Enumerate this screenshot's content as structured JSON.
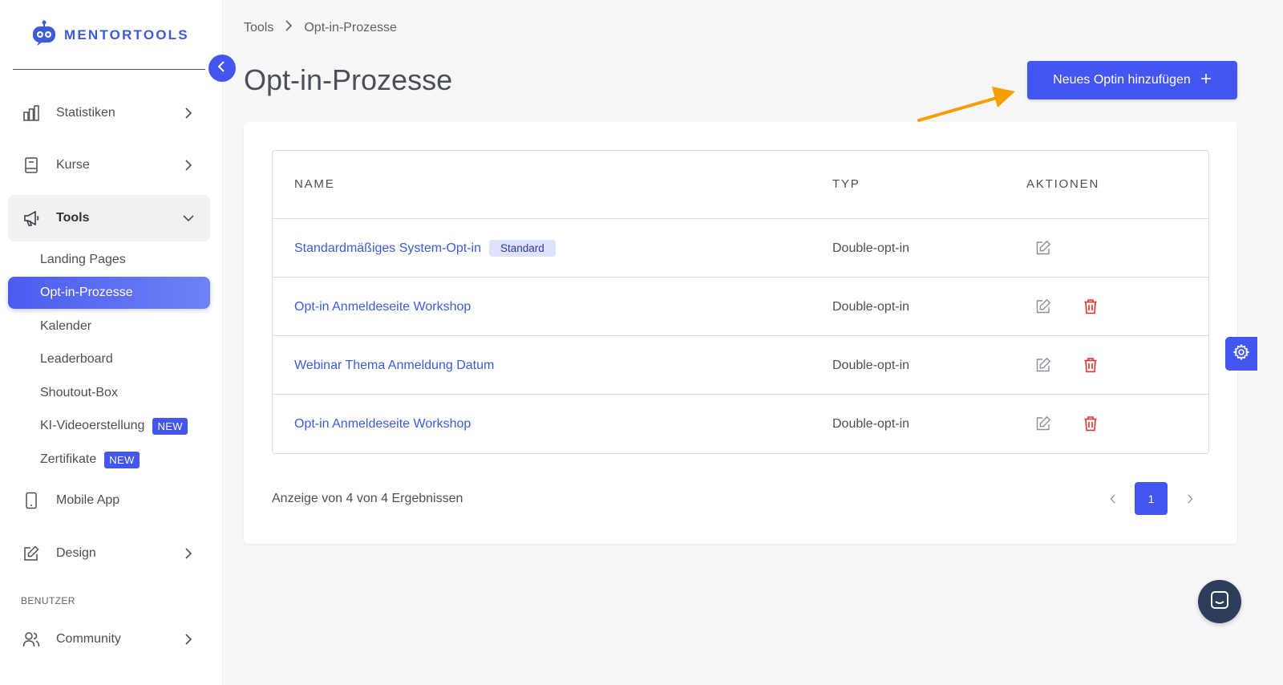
{
  "brand": {
    "name": "MENTORTOOLS"
  },
  "sidebar": {
    "items": [
      {
        "label": "Statistiken",
        "icon": "bar-chart-icon"
      },
      {
        "label": "Kurse",
        "icon": "book-icon"
      },
      {
        "label": "Tools",
        "icon": "megaphone-icon"
      },
      {
        "label": "Mobile App",
        "icon": "smartphone-icon"
      },
      {
        "label": "Design",
        "icon": "pen-square-icon"
      },
      {
        "label": "Community",
        "icon": "users-icon"
      }
    ],
    "tools_sub": [
      {
        "label": "Landing Pages"
      },
      {
        "label": "Opt-in-Prozesse"
      },
      {
        "label": "Kalender"
      },
      {
        "label": "Leaderboard"
      },
      {
        "label": "Shoutout-Box"
      },
      {
        "label": "KI-Videoerstellung",
        "badge": "NEW"
      },
      {
        "label": "Zertifikate",
        "badge": "NEW"
      }
    ],
    "section_benutzer": "BENUTZER"
  },
  "breadcrumb": {
    "parent": "Tools",
    "current": "Opt-in-Prozesse"
  },
  "page": {
    "title": "Opt-in-Prozesse",
    "add_button": "Neues Optin hinzufügen"
  },
  "table": {
    "headers": {
      "name": "NAME",
      "typ": "TYP",
      "aktionen": "AKTIONEN"
    },
    "rows": [
      {
        "name": "Standardmäßiges System-Opt-in",
        "badge": "Standard",
        "typ": "Double-opt-in",
        "deletable": false
      },
      {
        "name": "Opt-in Anmeldeseite Workshop",
        "typ": "Double-opt-in",
        "deletable": true
      },
      {
        "name": "Webinar Thema Anmeldung Datum",
        "typ": "Double-opt-in",
        "deletable": true
      },
      {
        "name": "Opt-in Anmeldeseite Workshop",
        "typ": "Double-opt-in",
        "deletable": true
      }
    ]
  },
  "pagination": {
    "summary": "Anzeige von 4 von 4 Ergebnissen",
    "current_page": "1"
  },
  "colors": {
    "accent": "#4356f0",
    "link": "#3b5bdb",
    "delete": "#e03131",
    "annotation_arrow": "#f59f00",
    "chat": "#2d3e5c"
  }
}
